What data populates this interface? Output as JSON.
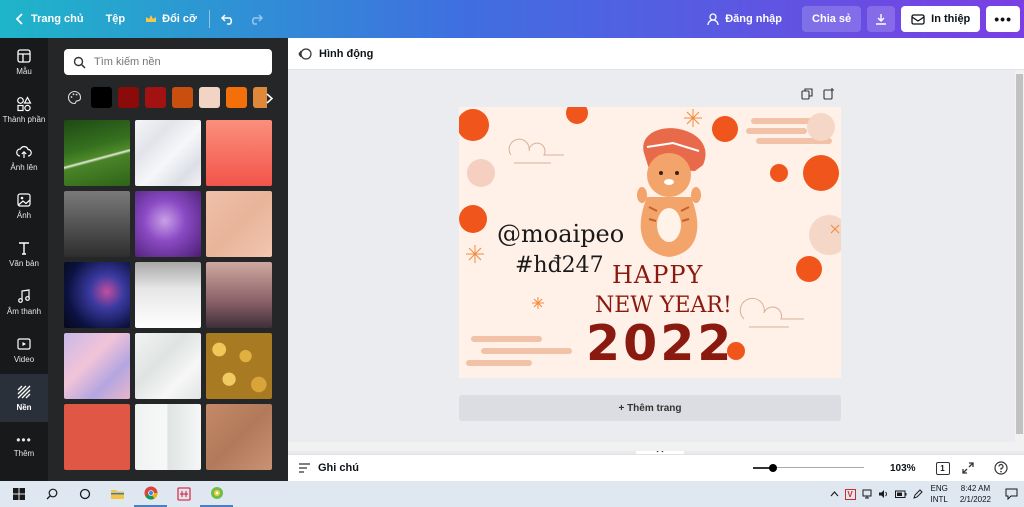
{
  "topbar": {
    "home_label": "Trang chủ",
    "file_label": "Tệp",
    "resize_label": "Đổi cỡ",
    "login_label": "Đăng nhập",
    "share_label": "Chia sẻ",
    "print_label": "In thiệp"
  },
  "rail": {
    "items": [
      {
        "label": "Mẫu",
        "icon": "template-icon"
      },
      {
        "label": "Thành phần",
        "icon": "elements-icon"
      },
      {
        "label": "Ảnh lên",
        "icon": "upload-icon"
      },
      {
        "label": "Ảnh",
        "icon": "photo-icon"
      },
      {
        "label": "Văn bản",
        "icon": "text-icon"
      },
      {
        "label": "Âm thanh",
        "icon": "music-icon"
      },
      {
        "label": "Video",
        "icon": "video-icon"
      },
      {
        "label": "Nền",
        "icon": "background-icon"
      },
      {
        "label": "Thêm",
        "icon": "more-icon"
      }
    ]
  },
  "panel": {
    "search_placeholder": "Tìm kiếm nền",
    "swatches": [
      "#000000",
      "#8b0a0a",
      "#a31212",
      "#c84f0e",
      "#f2d4c4",
      "#f26f0a",
      "#e0883a"
    ]
  },
  "subbar": {
    "animate_label": "Hình động"
  },
  "design": {
    "handle": "@moaipeo",
    "hashtag": "#hđ247",
    "happy": "HAPPY",
    "new_year": "NEW YEAR!",
    "year": "2022"
  },
  "add_page_label": "+ Thêm trang",
  "bottombar": {
    "notes_label": "Ghi chú",
    "zoom": "103%",
    "page_count": "1"
  },
  "taskbar": {
    "lang1": "ENG",
    "lang2": "INTL",
    "time": "8:42 AM",
    "date": "2/1/2022"
  },
  "colors": {
    "accent_dark_red": "#8a1a10",
    "flower_orange": "#f0551b",
    "canvas_bg": "#fff0e8"
  }
}
